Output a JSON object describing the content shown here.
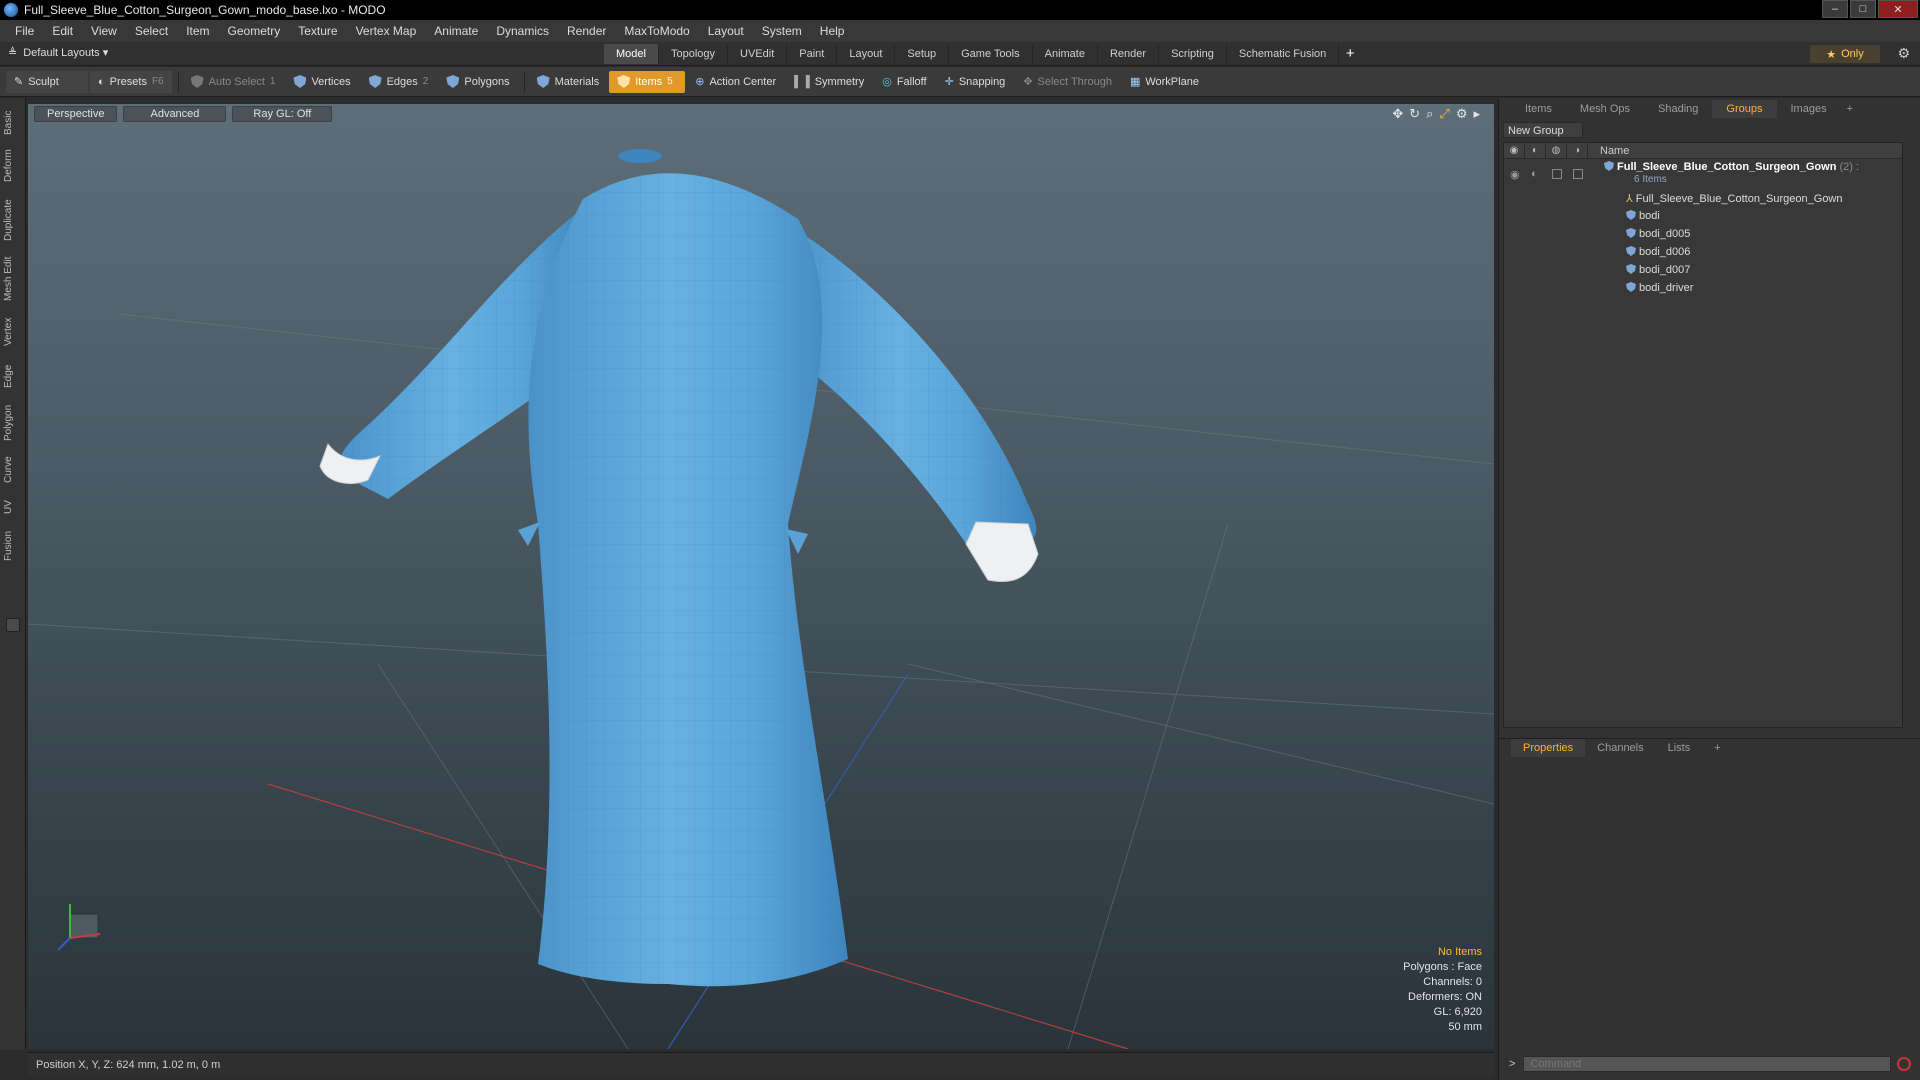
{
  "window": {
    "title": "Full_Sleeve_Blue_Cotton_Surgeon_Gown_modo_base.lxo - MODO",
    "controls": [
      "–",
      "□",
      "✕"
    ]
  },
  "menu": [
    "File",
    "Edit",
    "View",
    "Select",
    "Item",
    "Geometry",
    "Texture",
    "Vertex Map",
    "Animate",
    "Dynamics",
    "Render",
    "MaxToModo",
    "Layout",
    "System",
    "Help"
  ],
  "layout": {
    "preset_label": "Default Layouts ▾",
    "tabs": [
      "Model",
      "Topology",
      "UVEdit",
      "Paint",
      "Layout",
      "Setup",
      "Game Tools",
      "Animate",
      "Render",
      "Scripting",
      "Schematic Fusion"
    ],
    "active_tab": "Model",
    "add_label": "+",
    "only_label": "Only"
  },
  "toolbar": {
    "sculpt": "Sculpt",
    "presets": "Presets",
    "presets_key": "F6",
    "auto_select": "Auto Select",
    "vertices": "Vertices",
    "vertices_count": "1",
    "edges": "Edges",
    "edges_count": "2",
    "polygons": "Polygons",
    "materials": "Materials",
    "items": "Items",
    "items_count": "5",
    "action_center": "Action Center",
    "symmetry": "Symmetry",
    "falloff": "Falloff",
    "snapping": "Snapping",
    "select_through": "Select Through",
    "workplane": "WorkPlane"
  },
  "left_tabs": [
    "Basic",
    "Deform",
    "Duplicate",
    "Mesh Edit",
    "Vertex",
    "Edge",
    "Polygon",
    "Curve",
    "UV",
    "Fusion"
  ],
  "viewport": {
    "view_mode": "Perspective",
    "shading": "Advanced",
    "raygl": "Ray GL: Off",
    "info": {
      "selection": "No Items",
      "polygons": "Polygons : Face",
      "channels": "Channels: 0",
      "deformers": "Deformers: ON",
      "gl": "GL: 6,920",
      "focal": "50 mm"
    }
  },
  "status": {
    "position": "Position X, Y, Z:   624 mm, 1.02 m, 0 m"
  },
  "right_panel": {
    "tabs": [
      "Items",
      "Mesh Ops",
      "Shading",
      "Groups",
      "Images"
    ],
    "active_tab": "Groups",
    "add_label": "+",
    "new_group": "New Group",
    "name_header": "Name",
    "group": {
      "name": "Full_Sleeve_Blue_Cotton_Surgeon_Gown",
      "count": "(2) :",
      "subtitle": "6 Items"
    },
    "items": [
      {
        "name": "Full_Sleeve_Blue_Cotton_Surgeon_Gown",
        "kind": "locator"
      },
      {
        "name": "bodi",
        "kind": "mesh"
      },
      {
        "name": "bodi_d005",
        "kind": "mesh"
      },
      {
        "name": "bodi_d006",
        "kind": "mesh"
      },
      {
        "name": "bodi_d007",
        "kind": "mesh"
      },
      {
        "name": "bodi_driver",
        "kind": "mesh"
      }
    ],
    "bottom_tabs": [
      "Properties",
      "Channels",
      "Lists"
    ],
    "bottom_active": "Properties",
    "command_placeholder": "Command"
  }
}
